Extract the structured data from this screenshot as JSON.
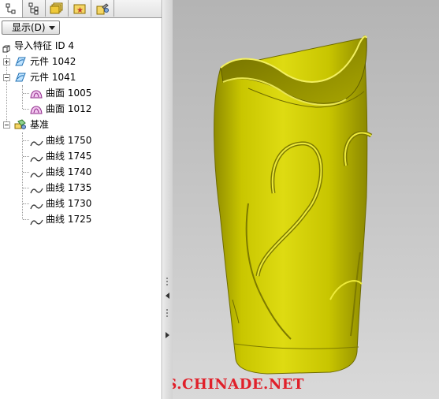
{
  "left_panel": {
    "tabs": [
      {
        "icon": "model-tree-icon"
      },
      {
        "icon": "layer-tree-icon"
      },
      {
        "icon": "folder-browser-icon"
      },
      {
        "icon": "favorites-icon"
      },
      {
        "icon": "connections-icon"
      }
    ],
    "show_button": {
      "label": "显示(D)"
    },
    "tree": {
      "root": {
        "label": "导入特征 ID 4",
        "icon": "import-feature-icon"
      },
      "nodes": [
        {
          "label": "元件 1042",
          "icon": "component-icon",
          "expanded": false
        },
        {
          "label": "元件 1041",
          "icon": "component-icon",
          "expanded": true,
          "children": [
            {
              "label": "曲面 1005",
              "icon": "surface-icon"
            },
            {
              "label": "曲面 1012",
              "icon": "surface-icon"
            }
          ]
        },
        {
          "label": "基准",
          "icon": "datum-icon",
          "expanded": true,
          "children": [
            {
              "label": "曲线 1750",
              "icon": "curve-icon"
            },
            {
              "label": "曲线 1745",
              "icon": "curve-icon"
            },
            {
              "label": "曲线 1740",
              "icon": "curve-icon"
            },
            {
              "label": "曲线 1735",
              "icon": "curve-icon"
            },
            {
              "label": "曲线 1730",
              "icon": "curve-icon"
            },
            {
              "label": "曲线 1725",
              "icon": "curve-icon"
            }
          ]
        }
      ]
    }
  },
  "viewport": {
    "model_color": "#cfcc00",
    "background_top": "#b4b4b4",
    "background_bottom": "#d9d9d9",
    "watermark": "BBS.CHINADE.NET",
    "watermark_color": "#e0202a"
  }
}
